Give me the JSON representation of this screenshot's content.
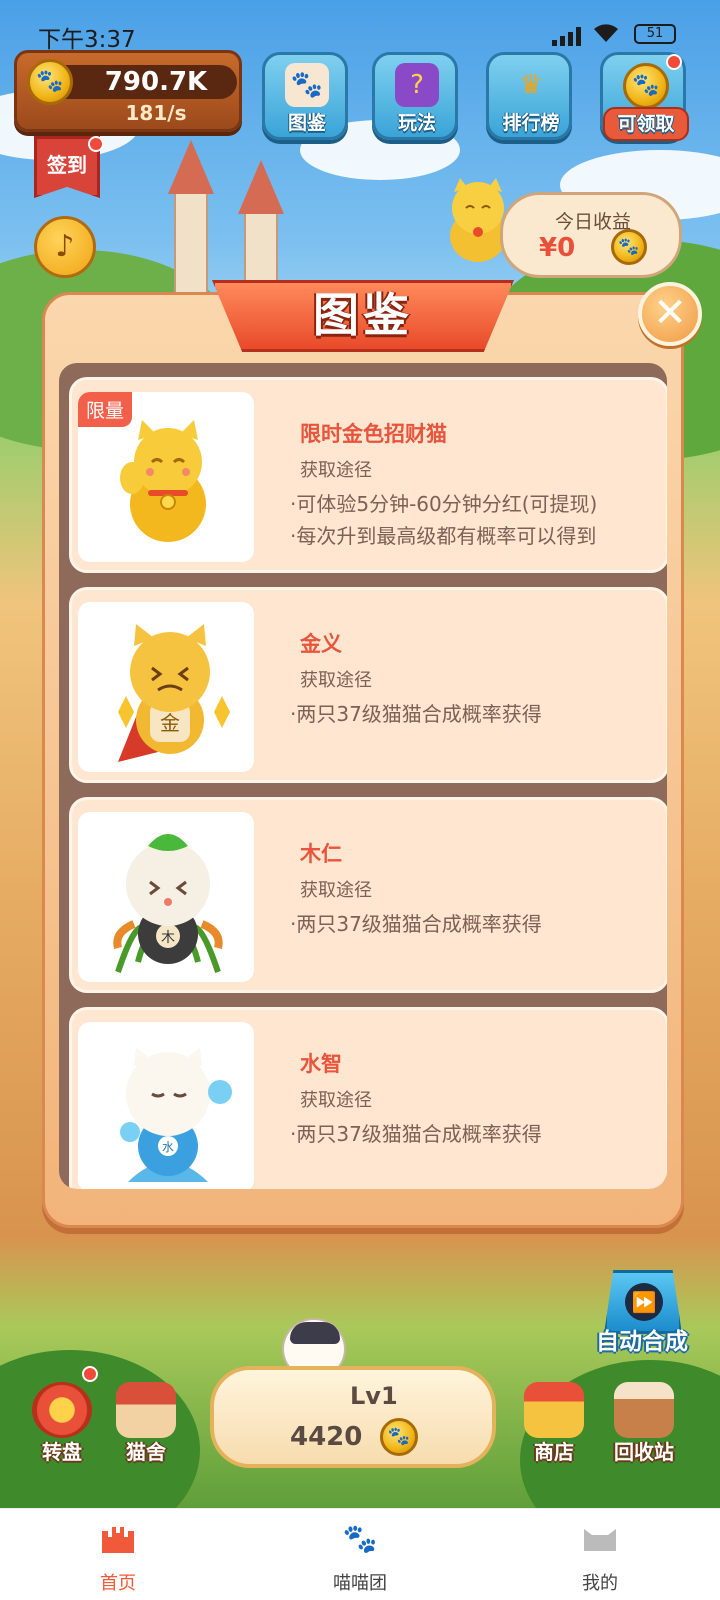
{
  "status_bar": {
    "time": "下午3:37",
    "battery": "51"
  },
  "hud": {
    "coins": "790.7K",
    "rate": "181/s",
    "buttons": [
      {
        "label": "图鉴",
        "icon": "album-icon"
      },
      {
        "label": "玩法",
        "icon": "question-book-icon"
      },
      {
        "label": "排行榜",
        "icon": "crown-icon"
      },
      {
        "label": "可领取",
        "icon": "coin-icon"
      }
    ],
    "signin": "签到",
    "today_title": "今日收益",
    "today_value": "¥0"
  },
  "modal": {
    "title": "图鉴",
    "cards": [
      {
        "tag": "限量",
        "name": "限时金色招财猫",
        "sub": "获取途径",
        "lines": [
          "·可体验5分钟-60分钟分红(可提现)",
          "·每次升到最高级都有概率可以得到"
        ]
      },
      {
        "tag": "",
        "name": "金义",
        "sub": "获取途径",
        "lines": [
          "·两只37级猫猫合成概率获得"
        ]
      },
      {
        "tag": "",
        "name": "木仁",
        "sub": "获取途径",
        "lines": [
          "·两只37级猫猫合成概率获得"
        ]
      },
      {
        "tag": "",
        "name": "水智",
        "sub": "获取途径",
        "lines": [
          "·两只37级猫猫合成概率获得"
        ]
      }
    ]
  },
  "game": {
    "auto_merge": "自动合成",
    "buy_level": "Lv1",
    "buy_cost": "4420",
    "items": [
      "转盘",
      "猫舍",
      "商店",
      "回收站"
    ]
  },
  "tabbar": {
    "tabs": [
      "首页",
      "喵喵团",
      "我的"
    ],
    "active_color": "#f05a3a",
    "inactive_color": "#444444"
  }
}
